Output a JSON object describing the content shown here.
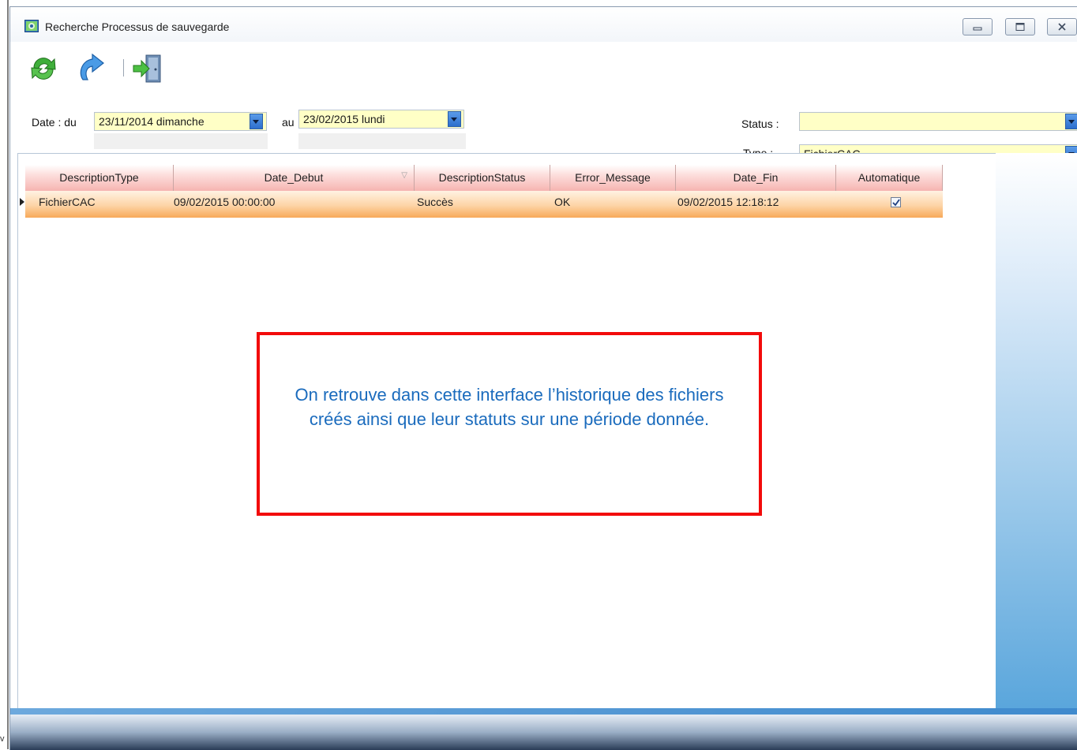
{
  "window": {
    "title": "Recherche Processus de sauvegarde"
  },
  "toolbar": {
    "items": [
      {
        "icon": "refresh-icon"
      },
      {
        "icon": "redo-icon"
      },
      {
        "icon": "exit-door-icon"
      }
    ]
  },
  "filters": {
    "date_label": "Date : du",
    "date_from": "23/11/2014 dimanche",
    "to_label": "au",
    "date_to": "23/02/2015 lundi",
    "status_label": "Status :",
    "status_value": "",
    "type_label": "Type :",
    "type_value": "FichierCAC"
  },
  "grid": {
    "columns": [
      "DescriptionType",
      "Date_Debut",
      "DescriptionStatus",
      "Error_Message",
      "Date_Fin",
      "Automatique"
    ],
    "rows": [
      {
        "DescriptionType": "FichierCAC",
        "Date_Debut": "09/02/2015 00:00:00",
        "DescriptionStatus": "Succès",
        "Error_Message": "OK",
        "Date_Fin": "09/02/2015 12:18:12",
        "Automatique": true
      }
    ]
  },
  "annotation": {
    "text": "On retrouve dans cette interface l’historique des fichiers créés ainsi que leur statuts sur une période donnée.",
    "border_color": "#f20b0b",
    "text_color": "#1a6bbd"
  },
  "left_edge_char": "v",
  "colors": {
    "field_bg": "#ffffc6",
    "header_pink": "#f6b4b1",
    "row_orange": "#f7a95a",
    "accent_blue": "#2d6fcd"
  }
}
